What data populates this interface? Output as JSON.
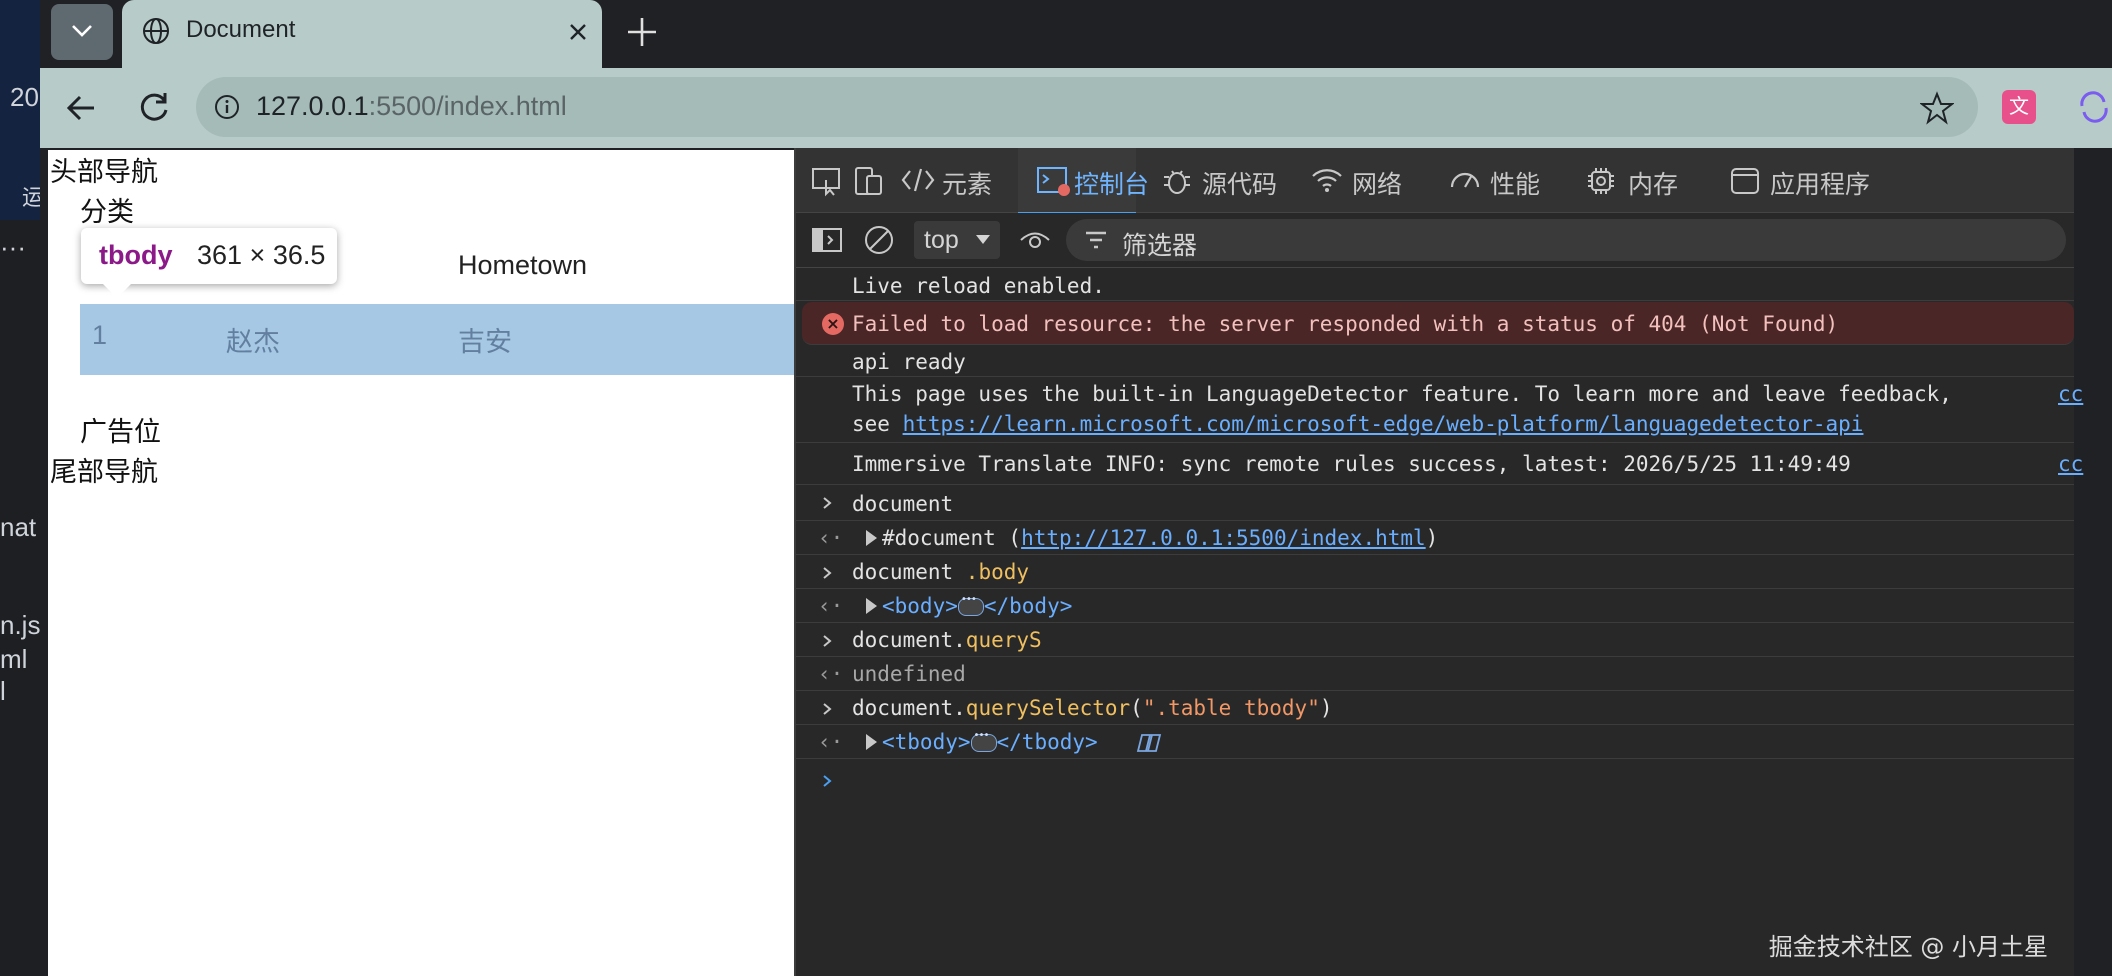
{
  "background_strip": {
    "texts": [
      "20",
      "运",
      "···",
      "nat",
      "n.js",
      "ml",
      "l"
    ]
  },
  "tab": {
    "title": "Document"
  },
  "address_bar": {
    "url_host": "127.0.0.1",
    "url_rest": ":5500/index.html"
  },
  "page": {
    "header_nav": "头部导航",
    "category": "分类",
    "table": {
      "hometown_header": "Hometown",
      "row": {
        "id": "1",
        "name": "赵杰",
        "hometown": "吉安"
      }
    },
    "ad_slot": "广告位",
    "footer_nav": "尾部导航",
    "tooltip": {
      "tag": "tbody",
      "size": "361 × 36.5"
    }
  },
  "devtools": {
    "tabs": [
      {
        "label": "元素",
        "icon": "code-icon"
      },
      {
        "label": "控制台",
        "icon": "console-icon",
        "active": true
      },
      {
        "label": "源代码",
        "icon": "bug-icon"
      },
      {
        "label": "网络",
        "icon": "wifi-icon"
      },
      {
        "label": "性能",
        "icon": "gauge-icon"
      },
      {
        "label": "内存",
        "icon": "chip-icon"
      },
      {
        "label": "应用程序",
        "icon": "app-icon"
      }
    ],
    "context": "top",
    "filter_placeholder": "筛选器",
    "console": {
      "live_reload": "Live reload enabled.",
      "error": "Failed to load resource: the server responded with a status of 404 (Not Found)",
      "api_ready": "api ready",
      "lang_line1": "This page uses the built-in LanguageDetector feature. To learn more and leave feedback,",
      "lang_see": "see ",
      "lang_link": "https://learn.microsoft.com/microsoft-edge/web-platform/languagedetector-api",
      "lang_src": "cc",
      "immersive": "Immersive Translate INFO: sync remote rules success, latest: 2026/5/25 11:49:49",
      "immersive_src": "cc",
      "in1": "document",
      "out1_prefix": "#document (",
      "out1_link": "http://127.0.0.1:5500/index.html",
      "out1_suffix": ")",
      "in2_a": "document ",
      "in2_b": ".body",
      "out2_open": "<body>",
      "out2_close": "</body>",
      "in3_a": "document.",
      "in3_b": "queryS",
      "out3": "undefined",
      "in4_a": "document.",
      "in4_b": "querySelector",
      "in4_c": "(",
      "in4_d": "\".table tbody\"",
      "in4_e": ")",
      "out4_open": "<tbody>",
      "out4_close": "</tbody>"
    },
    "watermark": "掘金技术社区 @ 小月土星"
  },
  "colors": {
    "accent": "#4aa0f0",
    "tab_bg": "#b7cbc8",
    "selection": "#a6c8e5",
    "error_bg": "#4a2626"
  }
}
